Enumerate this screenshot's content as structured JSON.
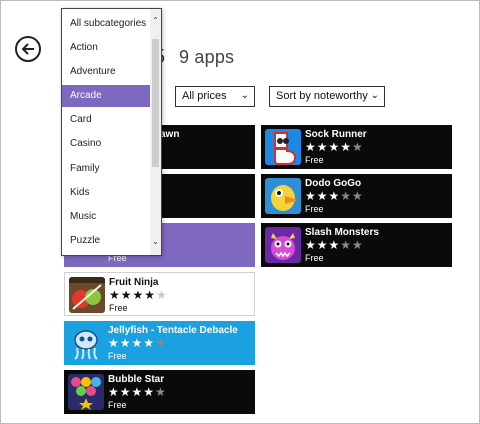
{
  "header": {
    "count_fragment": "5",
    "count_label": "9 apps"
  },
  "filters": {
    "subcategory": {
      "options": [
        "All subcategories",
        "Action",
        "Adventure",
        "Arcade",
        "Card",
        "Casino",
        "Family",
        "Kids",
        "Music",
        "Puzzle"
      ],
      "selected": "Arcade"
    },
    "price": {
      "selected": "All prices"
    },
    "sort": {
      "selected": "Sort by noteworthy"
    }
  },
  "apps_left": [
    {
      "name": "awn",
      "rating": 0,
      "price": "",
      "color": "#0a0a0a",
      "partial": true
    },
    {
      "name": "",
      "rating": 0,
      "price": "",
      "color": "#0a0a0a",
      "partial": true
    },
    {
      "name": "",
      "rating": 0,
      "price": "Free",
      "color": "#7f68bf",
      "partial": true
    },
    {
      "name": "Fruit Ninja",
      "rating": 4,
      "price": "Free",
      "color": "#ffffff",
      "thumb_icon": "fruit-ninja-icon"
    },
    {
      "name": "Jellyfish - Tentacle Debacle",
      "rating": 4,
      "price": "Free",
      "color": "#1ba1e2",
      "thumb_icon": "jellyfish-icon"
    },
    {
      "name": "Bubble Star",
      "rating": 4.5,
      "price": "Free",
      "color": "#0a0a0a",
      "thumb_icon": "bubble-star-icon"
    }
  ],
  "apps_right": [
    {
      "name": "Sock Runner",
      "rating": 4,
      "price": "Free",
      "color": "#0a0a0a",
      "thumb_icon": "sock-runner-icon"
    },
    {
      "name": "Dodo GoGo",
      "rating": 3.5,
      "price": "Free",
      "color": "#0a0a0a",
      "thumb_icon": "dodo-gogo-icon"
    },
    {
      "name": "Slash Monsters",
      "rating": 3,
      "price": "Free",
      "color": "#0a0a0a",
      "thumb_icon": "slash-monsters-icon"
    }
  ],
  "icons": {
    "back": "back-arrow-icon",
    "dropdown_chevron": "chevron-down-icon",
    "scroll_up": "chevron-up-icon"
  },
  "stars": {
    "r4": "★★★★",
    "r4_off": "★",
    "r45": "★★★★",
    "r45_half": "★",
    "r35": "★★★",
    "r35_half": "★",
    "r35_off": "★",
    "r3": "★★★",
    "r3_off": "★★"
  },
  "glyphs": {
    "chevron_down": "⌄",
    "chevron_up": "⌃"
  }
}
